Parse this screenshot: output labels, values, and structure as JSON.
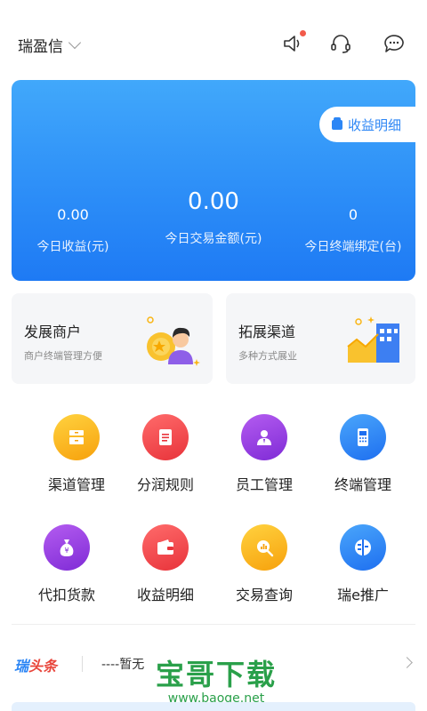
{
  "header": {
    "app_name": "瑞盈信",
    "icons": [
      "speaker-icon",
      "headset-icon",
      "chat-icon"
    ]
  },
  "banner": {
    "detail_button": "收益明细",
    "stats": [
      {
        "value": "0.00",
        "label": "今日收益(元)"
      },
      {
        "value": "0.00",
        "label": "今日交易金额(元)"
      },
      {
        "value": "0",
        "label": "今日终端绑定(台)"
      }
    ]
  },
  "cards": [
    {
      "title": "发展商户",
      "subtitle": "商户终端管理方便"
    },
    {
      "title": "拓展渠道",
      "subtitle": "多种方式展业"
    }
  ],
  "grid": [
    {
      "label": "渠道管理",
      "icon": "drawer-icon",
      "color": "#f9b515"
    },
    {
      "label": "分润规则",
      "icon": "document-icon",
      "color": "#f04848"
    },
    {
      "label": "员工管理",
      "icon": "person-icon",
      "color": "#9b3fe0"
    },
    {
      "label": "终端管理",
      "icon": "pos-terminal-icon",
      "color": "#2c86f5"
    },
    {
      "label": "代扣货款",
      "icon": "money-bag-icon",
      "color": "#9b3fe0"
    },
    {
      "label": "收益明细",
      "icon": "wallet-icon",
      "color": "#f04848"
    },
    {
      "label": "交易查询",
      "icon": "search-chart-icon",
      "color": "#f9b515"
    },
    {
      "label": "瑞e推广",
      "icon": "promote-icon",
      "color": "#2c86f5"
    }
  ],
  "news": {
    "logo_part1": "瑞",
    "logo_part2": "头条",
    "text": "----暂无"
  },
  "watermark": {
    "big": "宝哥下载",
    "small": "www.baoge.net"
  }
}
